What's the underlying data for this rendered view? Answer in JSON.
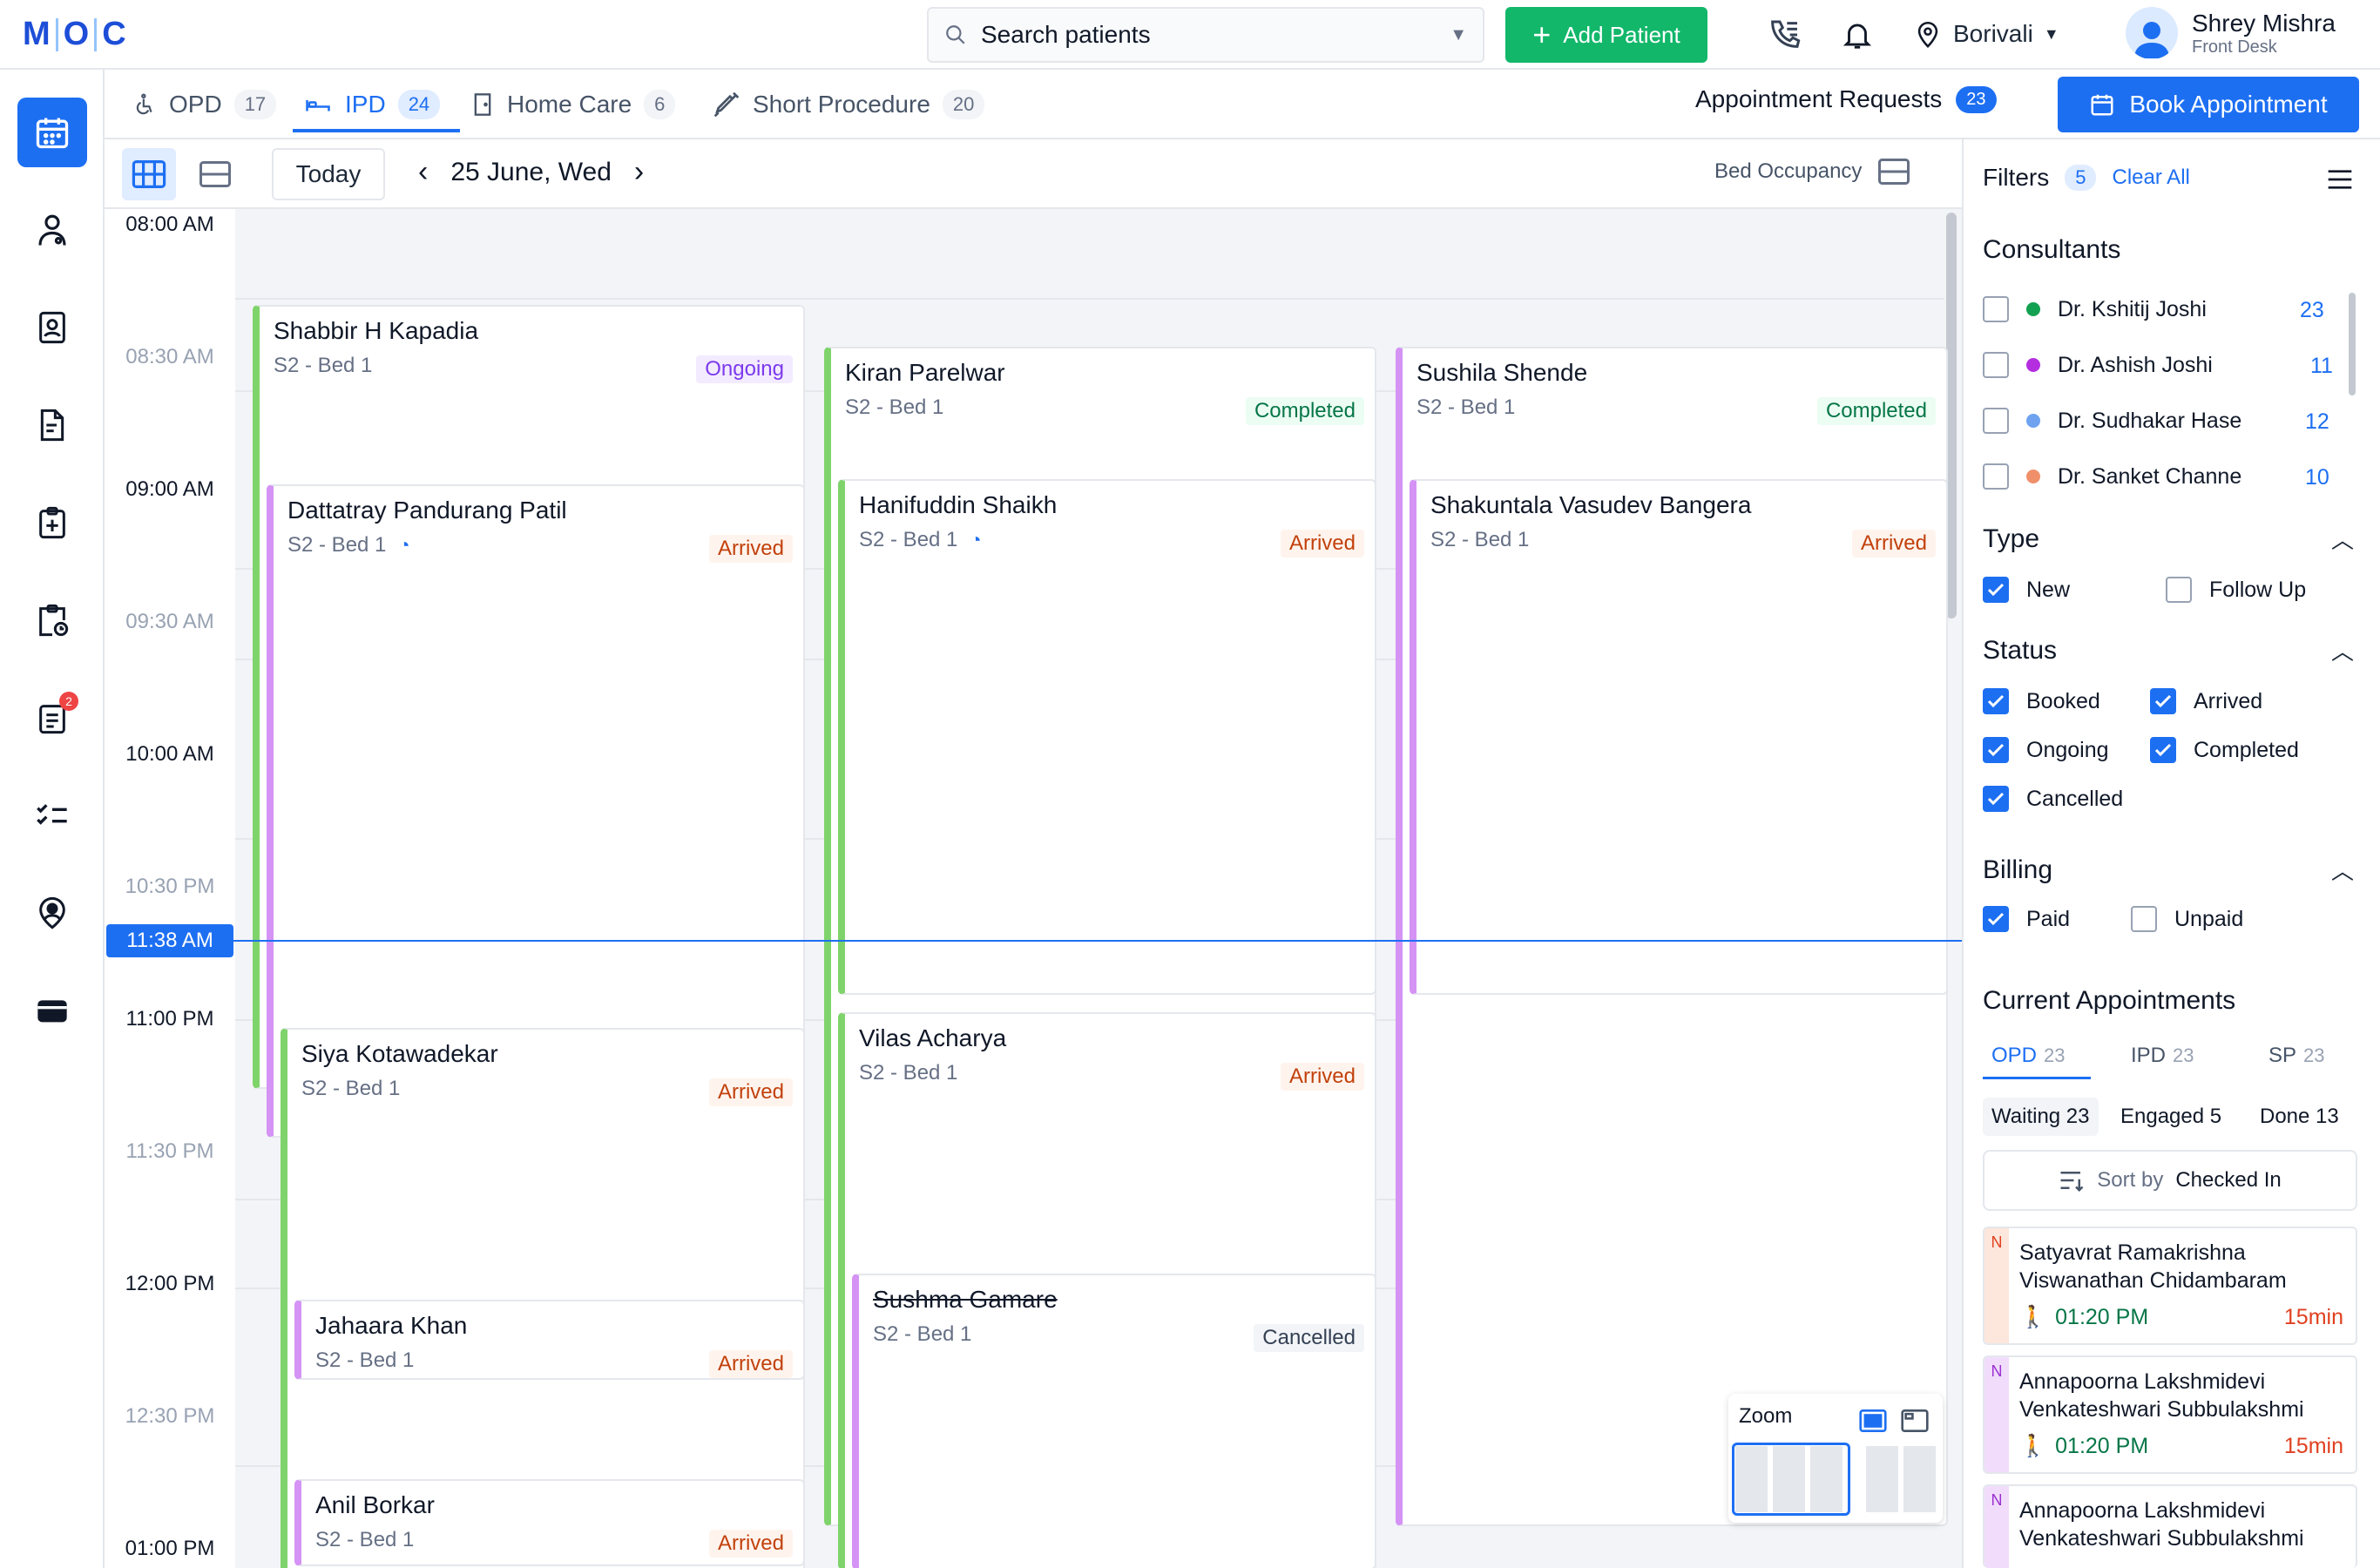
{
  "topbar": {
    "logo_letters": [
      "M",
      "O",
      "C"
    ],
    "search_placeholder": "Search patients",
    "add_patient": "Add Patient",
    "location": "Borivali",
    "user_name": "Shrey Mishra",
    "user_role": "Front Desk"
  },
  "nav": {
    "report_badge": "2"
  },
  "tabs": [
    {
      "label": "OPD",
      "count": "17"
    },
    {
      "label": "IPD",
      "count": "24"
    },
    {
      "label": "Home Care",
      "count": "6"
    },
    {
      "label": "Short Procedure",
      "count": "20"
    }
  ],
  "appointment_requests": {
    "label": "Appointment Requests",
    "count": "23"
  },
  "book_appointment": "Book Appointment",
  "toolbar": {
    "today": "Today",
    "date": "25 June, Wed",
    "bed_occupancy": "Bed Occupancy"
  },
  "timeline": {
    "labels": [
      "08:00 AM",
      "08:30 AM",
      "09:00 AM",
      "09:30 AM",
      "10:00 AM",
      "10:30 PM",
      "11:00 PM",
      "11:30 PM",
      "12:00 PM",
      "12:30 PM",
      "01:00 PM"
    ],
    "now": "11:38 AM"
  },
  "cards": [
    {
      "name": "Shabbir H Kapadia",
      "bed": "S2 - Bed 1",
      "status": "Ongoing"
    },
    {
      "name": "Dattatray Pandurang Patil",
      "bed": "S2 - Bed 1",
      "status": "Arrived"
    },
    {
      "name": "Siya Kotawadekar",
      "bed": "S2 - Bed 1",
      "status": "Arrived"
    },
    {
      "name": "Jahaara Khan",
      "bed": "S2 - Bed 1",
      "status": "Arrived"
    },
    {
      "name": "Anil Borkar",
      "bed": "S2 - Bed 1",
      "status": "Arrived"
    },
    {
      "name": "Kiran Parelwar",
      "bed": "S2 - Bed 1",
      "status": "Completed"
    },
    {
      "name": "Hanifuddin Shaikh",
      "bed": "S2 - Bed 1",
      "status": "Arrived"
    },
    {
      "name": "Vilas Acharya",
      "bed": "S2 - Bed 1",
      "status": "Arrived"
    },
    {
      "name": "Sushma Gamare",
      "bed": "S2 - Bed 1",
      "status": "Cancelled"
    },
    {
      "name": "Sushila Shende",
      "bed": "S2 - Bed 1",
      "status": "Completed"
    },
    {
      "name": "Shakuntala Vasudev Bangera",
      "bed": "S2 - Bed 1",
      "status": "Arrived"
    }
  ],
  "zoom": {
    "label": "Zoom"
  },
  "filters": {
    "title": "Filters",
    "count": "5",
    "clear": "Clear All",
    "consultants_title": "Consultants",
    "consultants": [
      {
        "name": "Dr. Kshitij Joshi",
        "count": "23",
        "color": "#12a150"
      },
      {
        "name": "Dr. Ashish Joshi",
        "count": "11",
        "color": "#b42ee0"
      },
      {
        "name": "Dr. Sudhakar Hase",
        "count": "12",
        "color": "#6fa3f0"
      },
      {
        "name": "Dr. Sanket Channe",
        "count": "10",
        "color": "#f0906a"
      }
    ],
    "type_title": "Type",
    "type_new": "New",
    "type_followup": "Follow Up",
    "status_title": "Status",
    "status": {
      "booked": "Booked",
      "arrived": "Arrived",
      "ongoing": "Ongoing",
      "completed": "Completed",
      "cancelled": "Cancelled"
    },
    "billing_title": "Billing",
    "paid": "Paid",
    "unpaid": "Unpaid"
  },
  "current": {
    "title": "Current Appointments",
    "tabs": [
      {
        "label": "OPD",
        "count": "23"
      },
      {
        "label": "IPD",
        "count": "23"
      },
      {
        "label": "SP",
        "count": "23"
      }
    ],
    "segs": [
      "Waiting 23",
      "Engaged 5",
      "Done 13"
    ],
    "sort_prefix": "Sort by",
    "sort_value": "Checked In",
    "patients": [
      {
        "tag": "N",
        "name": "Satyavrat Ramakrishna Viswanathan Chidambaram",
        "time": "01:20 PM",
        "wait": "15min"
      },
      {
        "tag": "N",
        "name": "Annapoorna Lakshmidevi Venkateshwari Subbulakshmi",
        "time": "01:20 PM",
        "wait": "15min"
      },
      {
        "tag": "N",
        "name": "Annapoorna Lakshmidevi Venkateshwari Subbulakshmi"
      }
    ]
  }
}
